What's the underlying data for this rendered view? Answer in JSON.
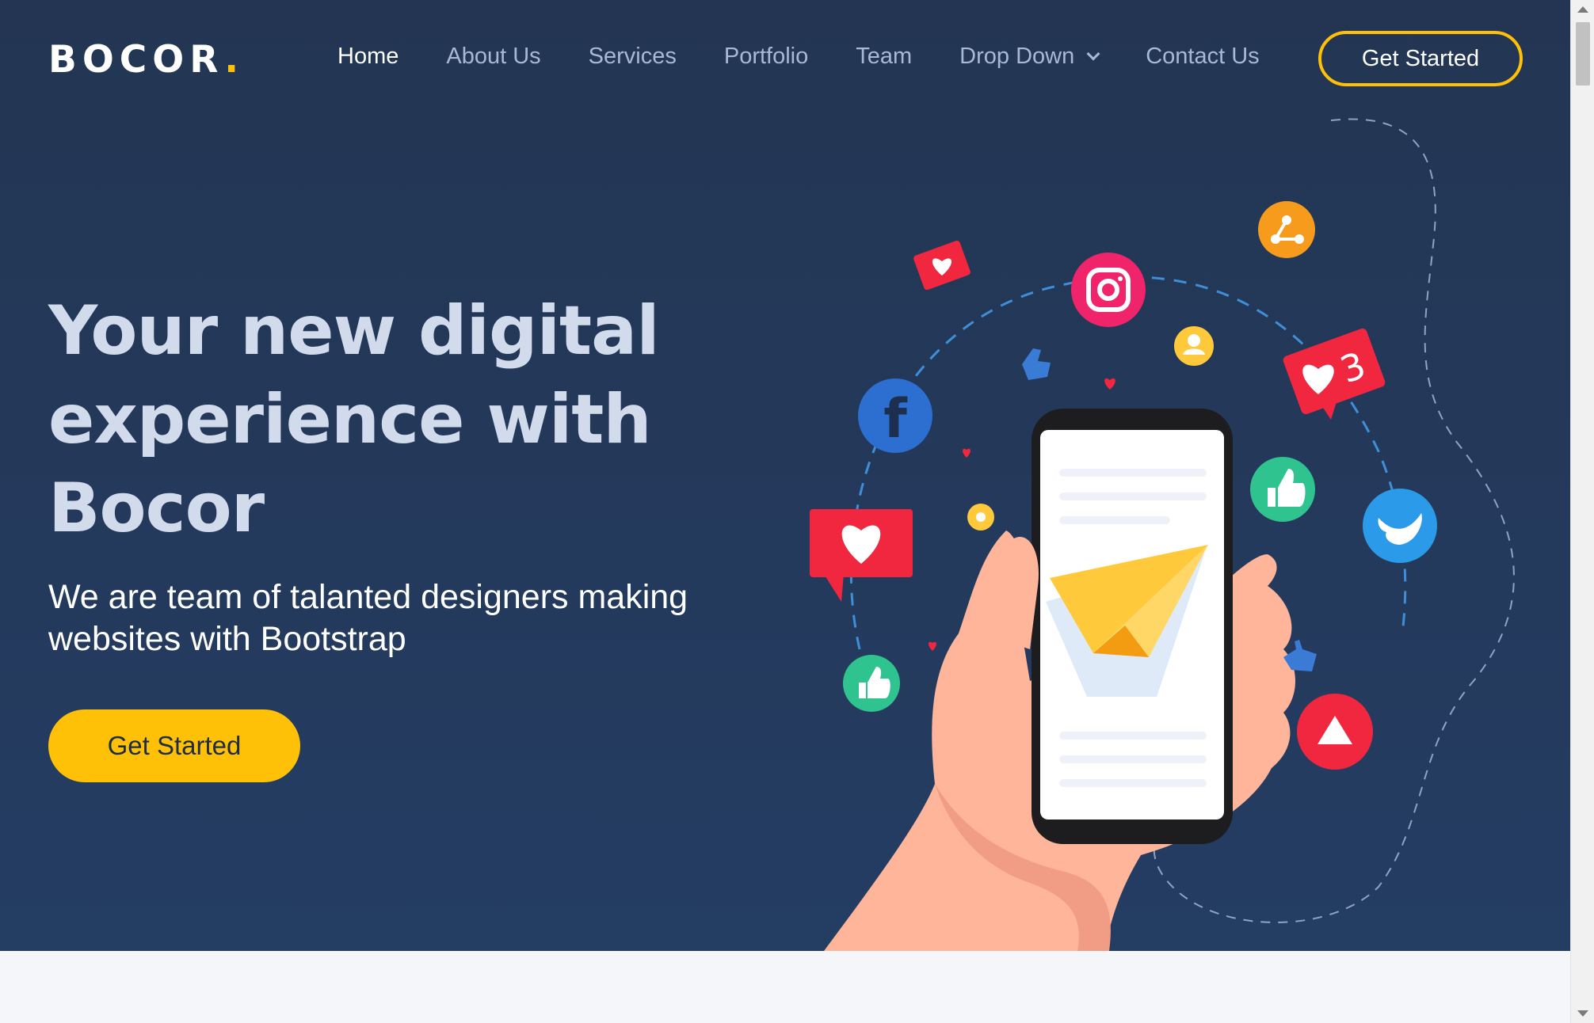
{
  "brand": {
    "name": "BOCOR",
    "dot": ".",
    "accent_color": "#ffc107"
  },
  "nav": {
    "items": [
      {
        "label": "Home",
        "active": true
      },
      {
        "label": "About Us"
      },
      {
        "label": "Services"
      },
      {
        "label": "Portfolio"
      },
      {
        "label": "Team"
      },
      {
        "label": "Drop Down",
        "has_dropdown": true
      },
      {
        "label": "Contact Us"
      }
    ],
    "cta_label": "Get Started"
  },
  "hero": {
    "title_line1": "Your new digital",
    "title_line2": "experience with",
    "title_line3": "Bocor",
    "subtitle_line1": "We are team of talanted designers making",
    "subtitle_line2": "websites with Bootstrap",
    "cta_label": "Get Started",
    "background_color": "#233552",
    "notification_count": "3"
  },
  "illustration_icons": [
    "hand-phone-icon",
    "paper-plane-icon",
    "facebook-icon",
    "instagram-icon",
    "twitter-icon",
    "youtube-icon",
    "share-icon",
    "user-icon",
    "heart-bubble-icon",
    "like-icon"
  ]
}
